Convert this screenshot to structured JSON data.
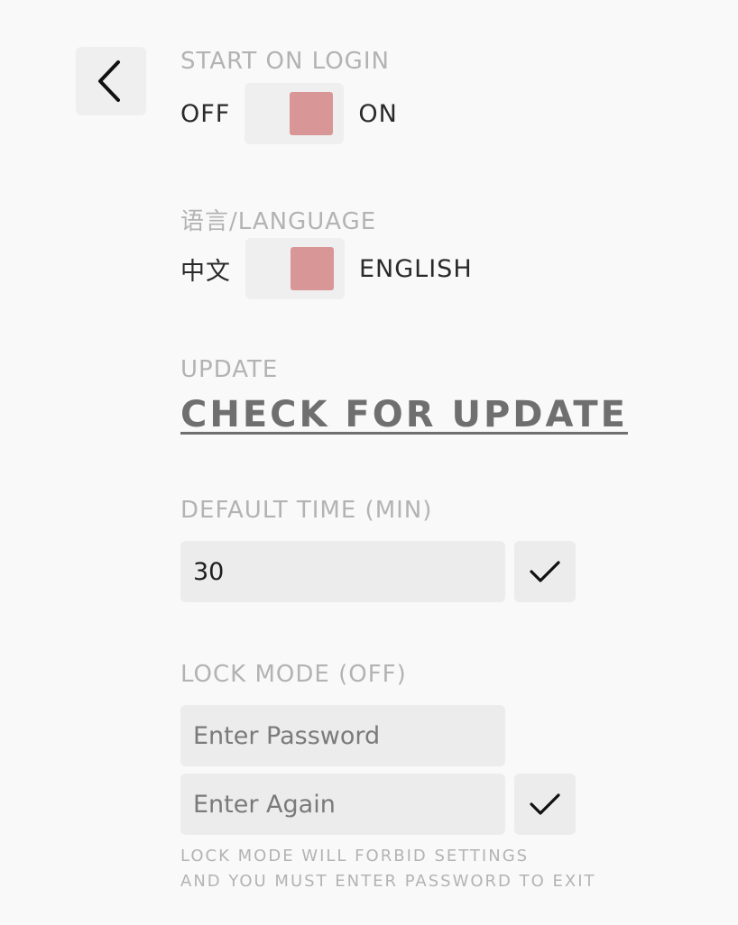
{
  "nav": {
    "back_icon": "chevron-left-icon"
  },
  "start_on_login": {
    "label": "START ON LOGIN",
    "off_label": "OFF",
    "on_label": "ON",
    "state": "on"
  },
  "language": {
    "label": "语言/LANGUAGE",
    "left_label": "中文",
    "right_label": "ENGLISH",
    "selected": "ENGLISH"
  },
  "update": {
    "label": "UPDATE",
    "link_text": "CHECK FOR UPDATE"
  },
  "default_time": {
    "label": "DEFAULT TIME (MIN)",
    "value": "30",
    "confirm_icon": "checkmark-icon"
  },
  "lock_mode": {
    "label": "LOCK MODE (OFF)",
    "password_placeholder": "Enter Password",
    "confirm_placeholder": "Enter Again",
    "confirm_icon": "checkmark-icon",
    "note_line1": "LOCK MODE WILL FORBID SETTINGS",
    "note_line2": "AND YOU MUST ENTER PASSWORD TO EXIT"
  },
  "colors": {
    "background": "#f9f9f9",
    "control_bg": "#efefef",
    "toggle_knob": "#d99696",
    "label_gray": "#b3b3b3",
    "link_gray": "#6f6f6f"
  }
}
